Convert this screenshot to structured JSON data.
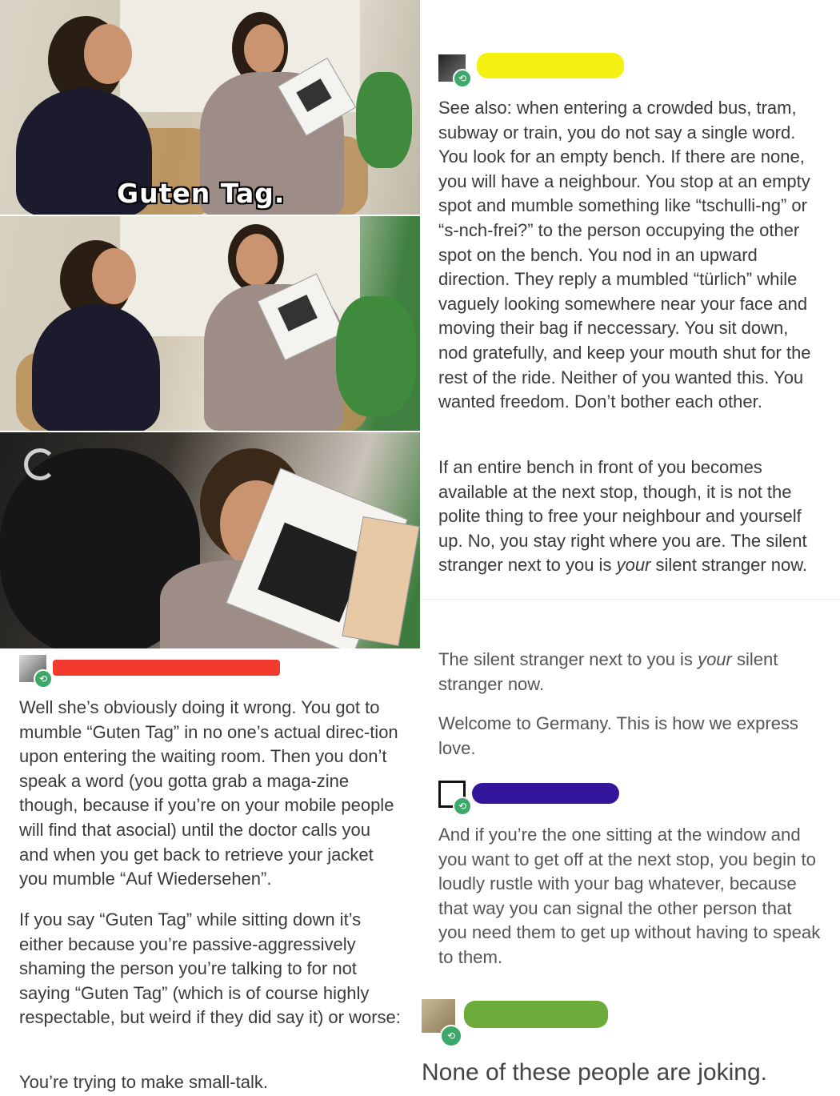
{
  "photo_panels": {
    "subtitle": "Guten Tag."
  },
  "colors": {
    "redact_yellow": "#f4f012",
    "redact_red": "#f23a2f",
    "redact_purple": "#34169c",
    "redact_green": "#6aab3a",
    "reblog_badge": "#3ca869"
  },
  "post_top_right": {
    "paragraphs": [
      "See also: when entering a crowded bus, tram, subway or train, you do not say a single word. You look for an empty bench. If there are none, you will have a neighbour. You stop at an empty spot and mumble something like “tschulli-ng” or “s-nch-frei?” to the person occupying the other spot on the bench. You nod in an upward direction. They reply a mumbled “türlich” while vaguely looking somewhere near your face and moving their bag if neccessary. You sit down, nod gratefully, and keep your mouth shut for the rest of the ride. Neither of you wanted this. You wanted freedom. Don’t bother each other.",
      "If an entire bench in front of you becomes available at the next stop, though, it is not the polite thing to free your neighbour and yourself up. No, you stay right where you are. The silent stranger next to you is",
      "your",
      "silent stranger now."
    ]
  },
  "post_mid_right": {
    "line_a": "The silent stranger next to you is",
    "line_a_em": "your",
    "line_a_end": "silent stranger now.",
    "line_b": "Welcome to Germany. This is how we express love."
  },
  "post_reply_right": {
    "text": "And if you’re the one sitting at the window and you want to get off at the next stop, you begin to loudly rustle with your bag whatever, because that way you can signal the other person that you need them to get up without having to speak to them."
  },
  "post_final_right": {
    "text": "None of these people are joking."
  },
  "post_left": {
    "p1": "Well she’s obviously doing it wrong. You got to mumble “Guten Tag” in no one’s actual direc-tion upon entering the waiting room. Then you don’t speak a word (you gotta grab a maga-zine though, because if you’re on your mobile people will find that asocial) until the doctor calls you and when you get back to retrieve your jacket you mumble “Auf Wiedersehen”.",
    "p2": "If you say “Guten Tag” while sitting down it’s either because you’re passive-aggressively shaming the person you’re talking to for not saying “Guten Tag” (which is of course highly respectable, but weird if they did say it) or worse:",
    "p3": "You’re trying to make small-talk."
  },
  "icons": {
    "reblog": "reblog-icon",
    "goethe_logo": "goethe-logo-icon"
  }
}
